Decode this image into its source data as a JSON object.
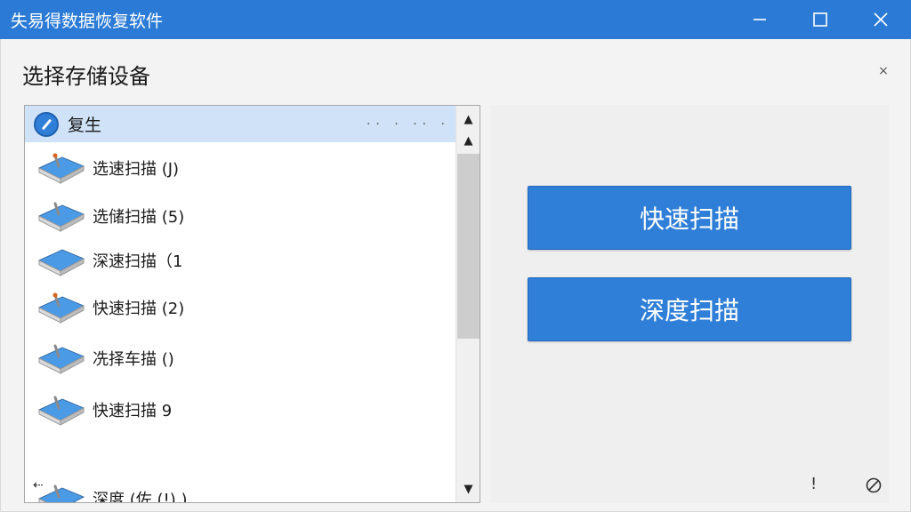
{
  "window": {
    "title": "失易得数据恢复软件",
    "controls": {
      "minimize": "minimize-icon",
      "maximize": "maximize-icon",
      "close": "close-icon"
    }
  },
  "dialog": {
    "heading": "选择存储设备",
    "close_glyph": "×"
  },
  "device_list": {
    "header": {
      "label": "复生",
      "dots": "·· · ·· ·"
    },
    "items": [
      {
        "label": "选速扫描 (J)"
      },
      {
        "label": "选储扫描 (5)"
      },
      {
        "label": "深速扫描（1"
      },
      {
        "label": "快速扫描 (2)"
      },
      {
        "label": "冼择车描 ()"
      },
      {
        "label": "快速扫描 9"
      },
      {
        "label": "深度 (佐 (!) )"
      }
    ],
    "scrollbar": {
      "up": "▲",
      "down": "▼"
    }
  },
  "actions": {
    "quick_scan": "快速扫描",
    "deep_scan": "深度扫描"
  },
  "footer": {
    "left_glyph": "⇠",
    "info_glyph": "!",
    "icons": [
      "pin-icon",
      "info-icon",
      "block-icon"
    ]
  },
  "colors": {
    "titlebar": "#2b7bd6",
    "accent": "#2f7fd8",
    "selection": "#cfe2f7"
  }
}
